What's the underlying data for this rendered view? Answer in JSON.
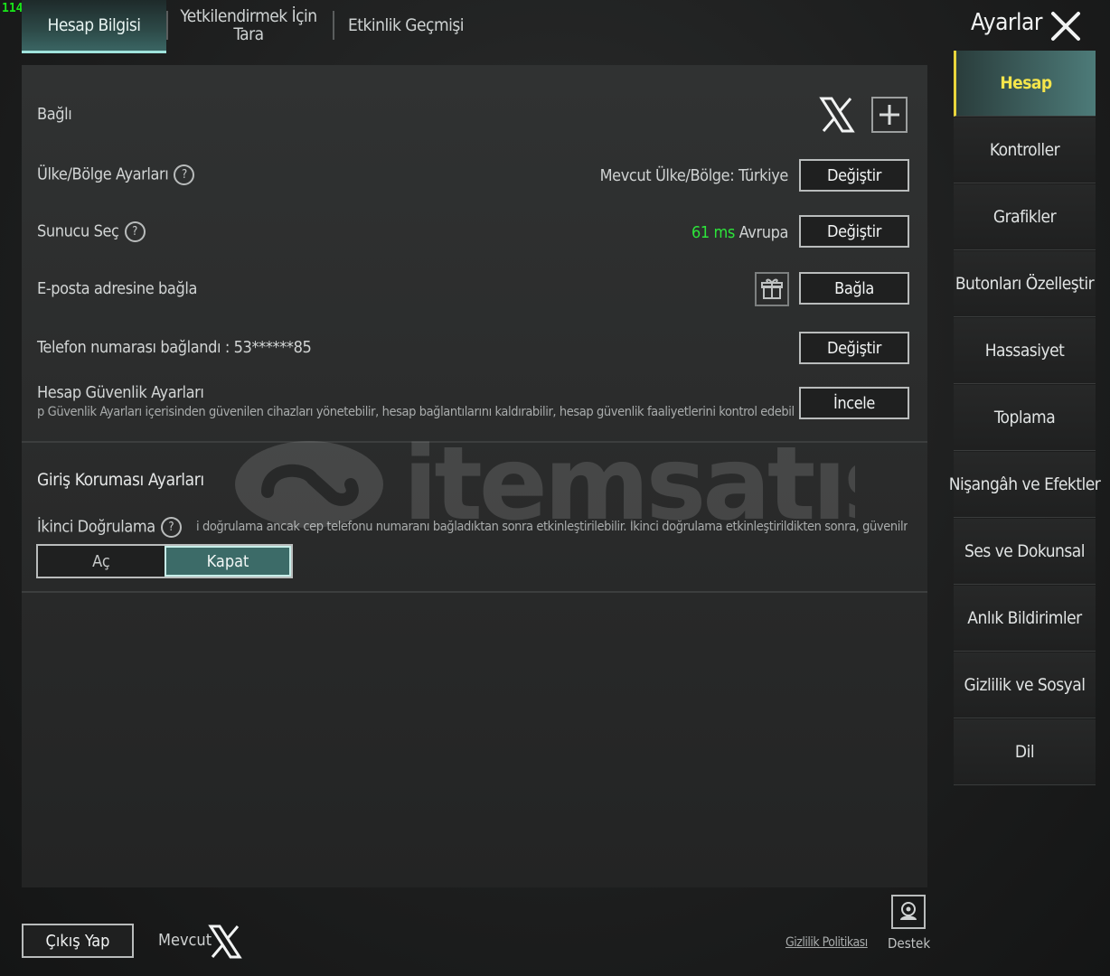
{
  "fps": "114",
  "tabs": [
    {
      "label": "Hesap Bilgisi",
      "active": true
    },
    {
      "label": "Yetkilendirmek İçin Tara",
      "active": false
    },
    {
      "label": "Etkinlik Geçmişi",
      "active": false
    }
  ],
  "header": {
    "title": "Ayarlar"
  },
  "rows": {
    "linked": {
      "label": "Bağlı"
    },
    "region": {
      "label": "Ülke/Bölge Ayarları",
      "status": "Mevcut Ülke/Bölge: Türkiye",
      "button": "Değiştir"
    },
    "server": {
      "label": "Sunucu Seç",
      "ping": "61 ms",
      "region": "Avrupa",
      "button": "Değiştir"
    },
    "email": {
      "label": "E-posta adresine bağla",
      "button": "Bağla"
    },
    "phone": {
      "label": "Telefon numarası bağlandı : 53******85",
      "button": "Değiştir"
    },
    "security": {
      "label": "Hesap Güvenlik Ayarları",
      "description": "p Güvenlik Ayarları içerisinden güvenilen cihazları yönetebilir, hesap bağlantılarını kaldırabilir, hesap güvenlik faaliyetlerini kontrol edebilir",
      "button": "İncele"
    }
  },
  "login_protection": {
    "title": "Giriş Koruması Ayarları",
    "twofa_label": "İkinci Doğrulama",
    "twofa_description": "i doğrulama ancak cep telefonu numaranı bağladıktan sonra etkinleştirilebilir. İkinci doğrulama etkinleştirildikten sonra, güvenilr",
    "toggle_on": "Aç",
    "toggle_off": "Kapat",
    "selected": "Kapat"
  },
  "sidenav": [
    {
      "label": "Hesap",
      "active": true
    },
    {
      "label": "Kontroller"
    },
    {
      "label": "Grafikler"
    },
    {
      "label": "Butonları Özelleştir"
    },
    {
      "label": "Hassasiyet"
    },
    {
      "label": "Toplama"
    },
    {
      "label": "Nişangâh ve Efektler"
    },
    {
      "label": "Ses ve Dokunsal"
    },
    {
      "label": "Anlık Bildirimler"
    },
    {
      "label": "Gizlilik ve Sosyal"
    },
    {
      "label": "Dil"
    }
  ],
  "footer": {
    "logout": "Çıkış Yap",
    "current": "Mevcut",
    "privacy": "Gizlilik Politikası",
    "support": "Destek"
  },
  "watermark": "itemsatis",
  "colors": {
    "accent_teal": "#3c6b68",
    "active_nav_text": "#f5e54b",
    "ping_green": "#2de43a"
  },
  "icons": [
    "x-logo-icon",
    "plus-icon",
    "help-icon",
    "gift-icon",
    "close-icon",
    "support-icon"
  ]
}
